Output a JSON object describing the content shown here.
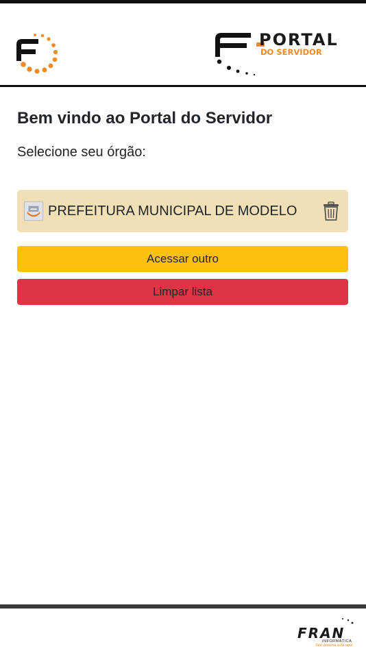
{
  "header": {
    "logo_left_icon": "f-dotted-circle-logo",
    "logo_right_text": "PORTAL",
    "logo_right_subtitle": "DO SERVIDOR"
  },
  "main": {
    "title": "Bem vindo ao Portal do Servidor",
    "select_label": "Selecione seu órgão:",
    "organizations": [
      {
        "name": "PREFEITURA MUNICIPAL DE MODELO",
        "emblem_icon": "municipal-emblem-icon",
        "action_icon": "trash-icon"
      }
    ],
    "access_other_label": "Acessar outro",
    "clear_list_label": "Limpar lista"
  },
  "footer": {
    "brand": "FRAN",
    "brand_sub": "INFORMÁTICA",
    "tagline": "Seu sistema está aqui"
  },
  "colors": {
    "accent_orange": "#f08a24",
    "org_item_bg": "#f1dfb6",
    "warning_button": "#fec00f",
    "danger_button": "#dd3545"
  }
}
